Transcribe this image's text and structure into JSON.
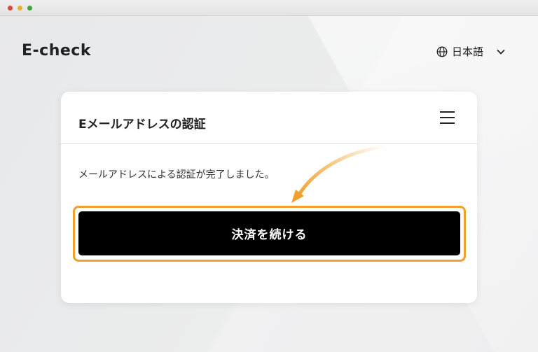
{
  "brand": "E-check",
  "language": {
    "label": "日本語"
  },
  "card": {
    "title": "Eメールアドレスの認証",
    "message": "メールアドレスによる認証が完了しました。",
    "cta_label": "決済を続ける"
  },
  "colors": {
    "highlight": "#f0a02c",
    "button": "#000000",
    "button_text": "#ffffff"
  },
  "icons": [
    "globe-icon",
    "chevron-down-icon",
    "menu-icon",
    "arrow-indicator"
  ]
}
